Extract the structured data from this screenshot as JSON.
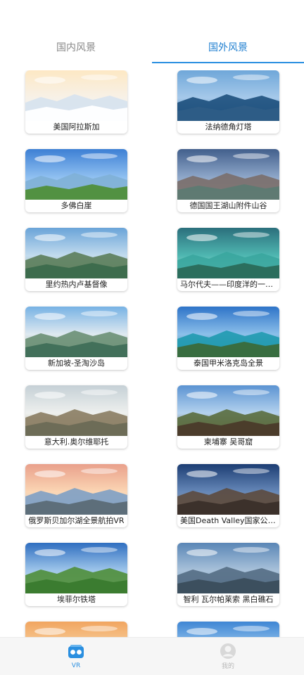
{
  "tabs": [
    {
      "label": "国内风景",
      "active": false
    },
    {
      "label": "国外风景",
      "active": true
    }
  ],
  "cards": [
    {
      "title": "美国阿拉斯加",
      "scene": "snow"
    },
    {
      "title": "法纳德角灯塔",
      "scene": "coast"
    },
    {
      "title": "多佛白崖",
      "scene": "cliffs"
    },
    {
      "title": "德国国王湖山附件山谷",
      "scene": "valley"
    },
    {
      "title": "里约热内卢基督像",
      "scene": "rio"
    },
    {
      "title": "马尔代夫——印度洋的一片...",
      "scene": "maldives"
    },
    {
      "title": "新加坡-圣淘沙岛",
      "scene": "sentosa"
    },
    {
      "title": "泰国甲米洛克岛全景",
      "scene": "island"
    },
    {
      "title": "意大利.奥尔维耶托",
      "scene": "orvieto"
    },
    {
      "title": "柬埔寨 吴哥窟",
      "scene": "angkor"
    },
    {
      "title": "俄罗斯贝加尔湖全景航拍VR",
      "scene": "baikal"
    },
    {
      "title": "美国Death Valley国家公园...",
      "scene": "deathvalley"
    },
    {
      "title": "埃菲尔铁塔",
      "scene": "eiffel"
    },
    {
      "title": "智利 瓦尔帕莱索 黑白礁石",
      "scene": "chile"
    },
    {
      "title": "",
      "scene": "sunset"
    },
    {
      "title": "",
      "scene": "sky"
    }
  ],
  "bottom_nav": [
    {
      "label": "VR",
      "icon": "vr-headset-icon",
      "active": true
    },
    {
      "label": "我的",
      "icon": "user-icon",
      "active": false
    }
  ],
  "colors": {
    "accent": "#2a8fe0",
    "inactive": "#888888"
  }
}
